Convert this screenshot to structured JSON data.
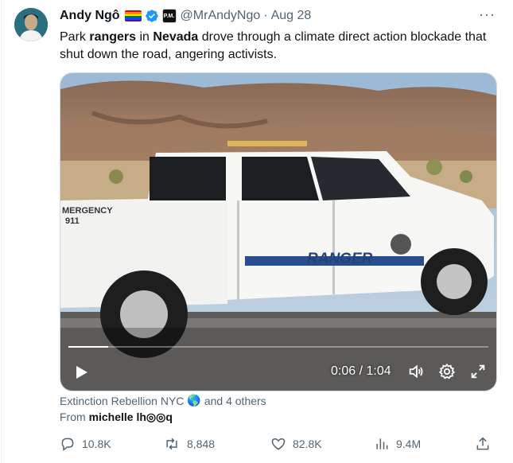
{
  "tweet": {
    "author_name": "Andy Ngô",
    "handle": "@MrAndyNgo",
    "separator": "·",
    "date": "Aug 28",
    "affiliate_badge_text": "P.M.",
    "more_label": "···",
    "text_parts": {
      "t1": "Park ",
      "b1": "rangers",
      "t2": " in ",
      "b2": "Nevada",
      "t3": " drove through a climate direct action blockade that shut down the road, angering activists."
    }
  },
  "video": {
    "time_display": "0:06 / 1:04",
    "progress_fraction": 0.094,
    "truck_door_text": "RANGER",
    "truck_side_text_1": "MERGENCY",
    "truck_side_text_2": "911",
    "icons": {
      "play": "play-icon",
      "volume": "volume-icon",
      "settings": "gear-icon",
      "fullscreen": "fullscreen-icon"
    }
  },
  "attribution": {
    "tagged": "Extinction Rebellion NYC",
    "globe": "🌎",
    "others": "and 4 others",
    "from_label": "From",
    "from_user": "michelle lh◎◎q"
  },
  "actions": {
    "replies": "10.8K",
    "reposts": "8,848",
    "likes": "82.8K",
    "views": "9.4M"
  },
  "colors": {
    "text": "#0f1419",
    "secondary": "#536471",
    "verified": "#1d9bf0"
  }
}
